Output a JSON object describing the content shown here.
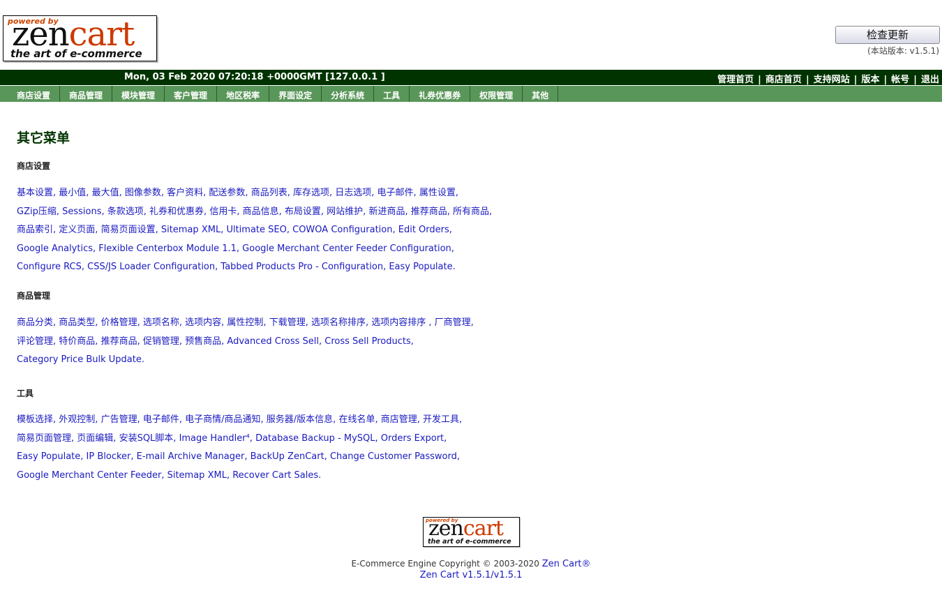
{
  "header": {
    "logo_powered": "powered by",
    "logo_zen": "zen",
    "logo_cart": "cart",
    "logo_tagline": "the art of e-commerce",
    "check_update_button": "检查更新",
    "version_text": "(本站版本: v1.5.1)"
  },
  "topbar": {
    "datetime": "Mon, 03 Feb 2020 07:20:18 +0000GMT [127.0.0.1 ]",
    "links": [
      "管理首页",
      "商店首页",
      "支持网站",
      "版本",
      "帐号",
      "退出"
    ]
  },
  "menu": [
    "商店设置",
    "商品管理",
    "模块管理",
    "客户管理",
    "地区税率",
    "界面设定",
    "分析系统",
    "工具",
    "礼券优惠券",
    "权限管理",
    "其他"
  ],
  "page_title": "其它菜单",
  "sections": [
    {
      "title": "商店设置",
      "rows": [
        [
          "基本设置",
          "最小值",
          "最大值",
          "图像参数",
          "客户资料",
          "配送参数",
          "商品列表",
          "库存选项",
          "日志选项",
          "电子邮件",
          "属性设置"
        ],
        [
          "GZip压缩",
          "Sessions",
          "条款选项",
          "礼券和优惠券",
          "信用卡",
          "商品信息",
          "布局设置",
          "网站维护",
          "新进商品",
          "推荐商品",
          "所有商品"
        ],
        [
          "商品索引",
          "定义页面",
          "简易页面设置",
          "Sitemap XML",
          "Ultimate SEO",
          "COWOA Configuration",
          "Edit Orders"
        ],
        [
          "Google Analytics",
          "Flexible Centerbox Module 1.1",
          "Google Merchant Center Feeder Configuration"
        ],
        [
          "Configure RCS",
          "CSS/JS Loader Configuration",
          "Tabbed Products Pro - Configuration",
          "Easy Populate"
        ]
      ]
    },
    {
      "title": "商品管理",
      "rows": [
        [
          "商品分类",
          "商品类型",
          "价格管理",
          "选项名称",
          "选项内容",
          "属性控制",
          "下载管理",
          "选项名称排序",
          "选项内容排序 ",
          "厂商管理"
        ],
        [
          "评论管理",
          "特价商品",
          "推荐商品",
          "促销管理",
          "预售商品",
          "Advanced Cross Sell",
          "Cross Sell Products"
        ],
        [
          "Category Price Bulk Update"
        ]
      ]
    },
    {
      "title": "工具",
      "rows": [
        [
          "模板选择",
          "外观控制",
          "广告管理",
          "电子邮件",
          "电子商情/商品通知",
          "服务器/版本信息",
          "在线名单",
          "商店管理",
          "开发工具"
        ],
        [
          "简易页面管理",
          "页面编辑",
          "安装SQL脚本",
          "Image Handler⁴",
          "Database Backup - MySQL",
          "Orders Export"
        ],
        [
          "Easy Populate",
          "IP Blocker",
          "E-mail Archive Manager",
          "BackUp ZenCart",
          "Change Customer Password"
        ],
        [
          "Google Merchant Center Feeder",
          "Sitemap XML",
          "Recover Cart Sales"
        ]
      ]
    }
  ],
  "footer": {
    "logo_powered": "powered by",
    "logo_zen": "zen",
    "logo_cart": "cart",
    "logo_tagline": "the art of e-commerce",
    "copyright": "E-Commerce Engine Copyright © 2003-2020",
    "zen_cart_link": "Zen Cart®",
    "version_link": "Zen Cart v1.5.1/v1.5.1"
  }
}
